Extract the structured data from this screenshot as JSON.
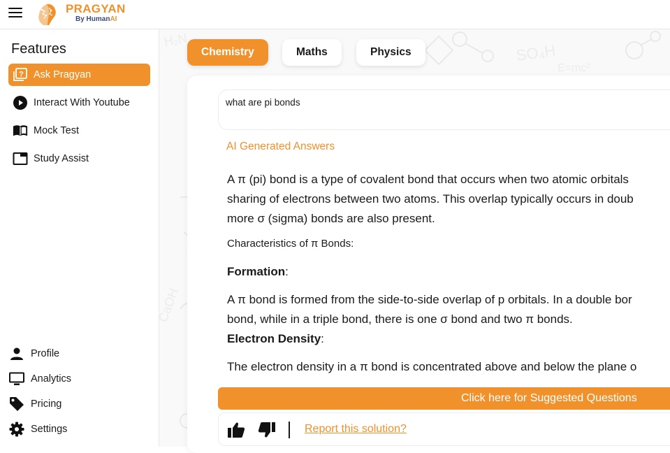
{
  "topbar": {
    "menu_icon": "menu-icon",
    "logo_icon": "brain-logo-icon",
    "brand_name": "PRAGYAN",
    "brand_sub_prefix": "By Human",
    "brand_sub_suffix": "AI"
  },
  "sidebar": {
    "heading": "Features",
    "items": [
      {
        "label": "Ask Pragyan",
        "icon": "ask-question-icon",
        "active": true
      },
      {
        "label": "Interact With Youtube",
        "icon": "play-circle-icon",
        "active": false
      },
      {
        "label": "Mock Test",
        "icon": "book-icon",
        "active": false
      },
      {
        "label": "Study Assist",
        "icon": "window-icon",
        "active": false
      }
    ],
    "bottom_items": [
      {
        "label": "Profile",
        "icon": "person-icon"
      },
      {
        "label": "Analytics",
        "icon": "monitor-icon"
      },
      {
        "label": "Pricing",
        "icon": "tag-icon"
      },
      {
        "label": "Settings",
        "icon": "gear-icon"
      }
    ]
  },
  "tabs": [
    {
      "label": "Chemistry",
      "active": true
    },
    {
      "label": "Maths",
      "active": false
    },
    {
      "label": "Physics",
      "active": false
    }
  ],
  "query": {
    "value": "what are pi bonds"
  },
  "answer": {
    "label": "AI Generated Answers",
    "intro_lines": [
      "A π (pi) bond is a type of covalent bond that occurs when two atomic orbitals",
      "sharing of electrons between two atoms. This overlap typically occurs in doub",
      "more σ (sigma) bonds are also present."
    ],
    "characteristics": "Characteristics of π Bonds:",
    "formation_heading": "Formation",
    "colon": ":",
    "formation_lines": [
      "A π bond is formed from the side-to-side overlap of p orbitals. In a double bor",
      "bond, while in a triple bond, there is one σ bond and two π bonds."
    ],
    "density_heading": "Electron Density",
    "density_line": "The electron density in a π bond is concentrated above and below the plane o"
  },
  "suggest_button": "Click here for Suggested Questions",
  "feedback": {
    "thumbs_up_icon": "thumbs-up-icon",
    "thumbs_down_icon": "thumbs-down-icon",
    "report_link": "Report this solution?"
  },
  "colors": {
    "accent": "#f0912c",
    "brand_navy": "#3a4a7a"
  }
}
